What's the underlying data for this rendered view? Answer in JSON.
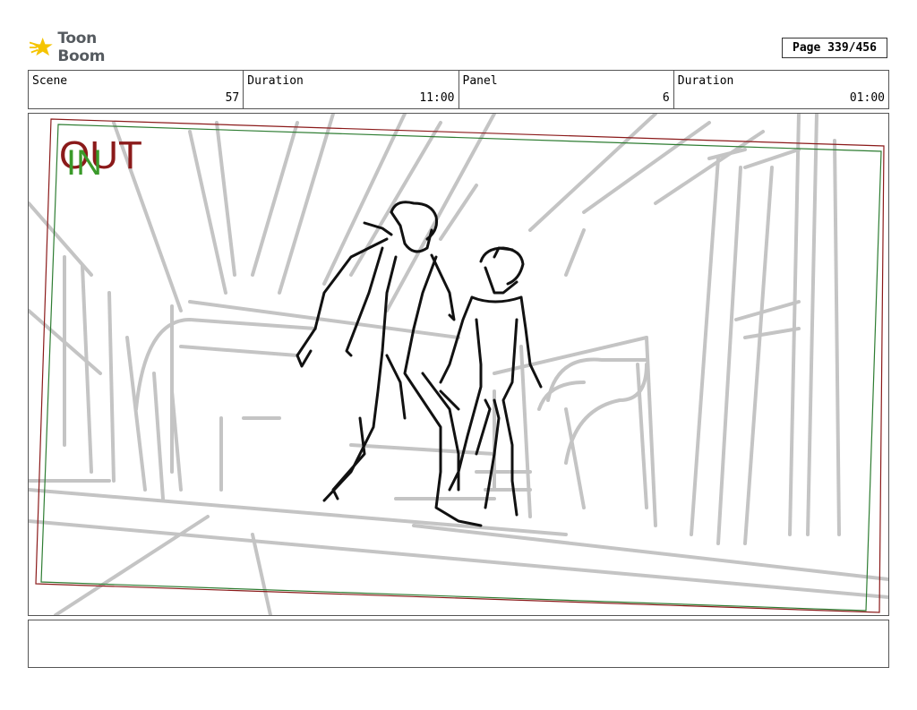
{
  "header": {
    "logo_text": "Toon Boom",
    "page_label": "Page 339/456"
  },
  "info": [
    {
      "label": "Scene",
      "value": "57"
    },
    {
      "label": "Duration",
      "value": "11:00"
    },
    {
      "label": "Panel",
      "value": "6"
    },
    {
      "label": "Duration",
      "value": "01:00"
    }
  ],
  "panel": {
    "out_marker": "OUT",
    "in_marker": "IN",
    "out_frame_color": "#8b1a1a",
    "in_frame_color": "#2e7d32",
    "sketch_gray": "#c4c4c4"
  }
}
